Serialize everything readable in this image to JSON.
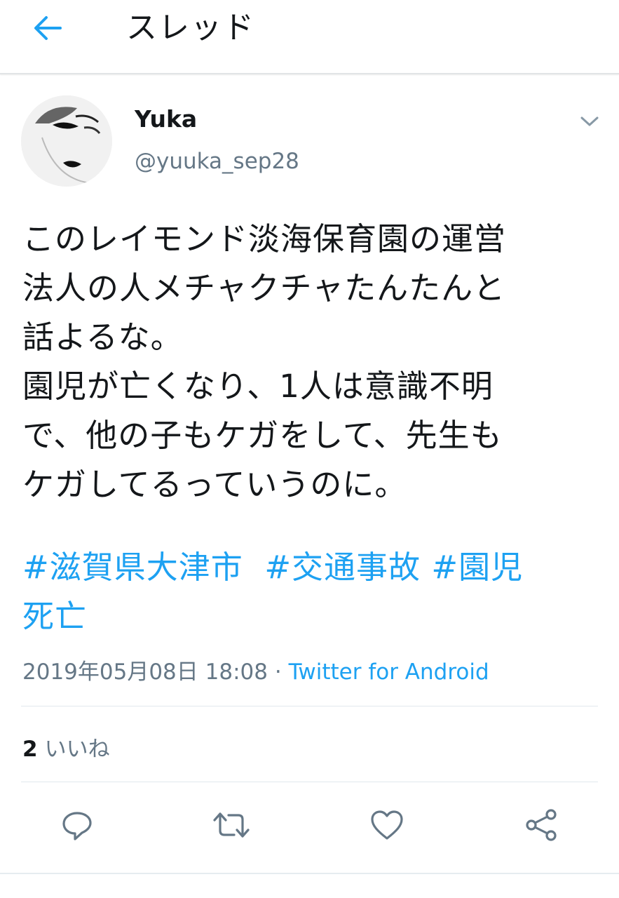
{
  "header": {
    "title": "スレッド"
  },
  "tweet": {
    "user_name": "Yuka",
    "user_handle": "@yuuka_sep28",
    "text": "このレイモンド淡海保育園の運営\n法人の人メチャクチャたんたんと\n話よるな。\n園児が亡くなり、1人は意識不明\nで、他の子もケガをして、先生も\nケガしてるっていうのに。",
    "hashtags": [
      "#滋賀県大津市",
      "#交通事故",
      "#園児",
      "死亡"
    ],
    "timestamp": "2019年05月08日 18:08",
    "separator": "·",
    "source": "Twitter for Android"
  },
  "stats": {
    "likes_count": "2",
    "likes_label": "いいね"
  },
  "colors": {
    "accent": "#1da1f2",
    "text": "#14171a",
    "muted": "#657786",
    "divider": "#e1e8ed"
  },
  "icons": [
    "back-arrow-icon",
    "chevron-down-icon",
    "reply-icon",
    "retweet-icon",
    "like-icon",
    "share-icon"
  ]
}
